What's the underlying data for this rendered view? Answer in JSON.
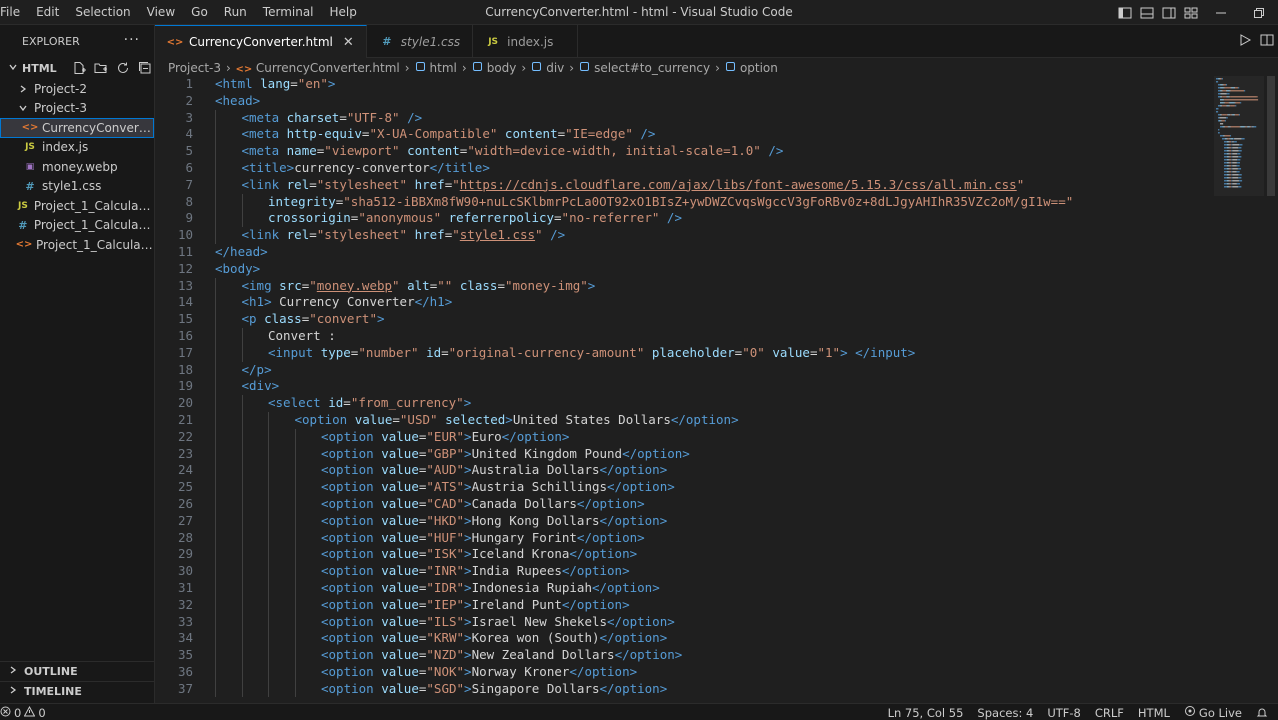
{
  "window": {
    "title": "CurrencyConverter.html - html - Visual Studio Code"
  },
  "menu": [
    "File",
    "Edit",
    "Selection",
    "View",
    "Go",
    "Run",
    "Terminal",
    "Help"
  ],
  "sidebar": {
    "header": "EXPLORER",
    "more": "···",
    "folder": "HTML",
    "items": [
      {
        "label": "Project-2",
        "type": "folder",
        "expanded": false,
        "depth": 1
      },
      {
        "label": "Project-3",
        "type": "folder",
        "expanded": true,
        "depth": 1
      },
      {
        "label": "CurrencyConverter.h...",
        "type": "html",
        "depth": 2,
        "selected": true
      },
      {
        "label": "index.js",
        "type": "js",
        "depth": 2
      },
      {
        "label": "money.webp",
        "type": "img",
        "depth": 2
      },
      {
        "label": "style1.css",
        "type": "css",
        "depth": 2
      },
      {
        "label": "Project_1_Calculator_...",
        "type": "js",
        "depth": 1
      },
      {
        "label": "Project_1_Calculator_...",
        "type": "css",
        "depth": 1
      },
      {
        "label": "Project_1_Calculator.h...",
        "type": "html",
        "depth": 1
      }
    ],
    "sections": [
      "OUTLINE",
      "TIMELINE"
    ]
  },
  "icons": {
    "html": "<>",
    "js": "JS",
    "css": "#",
    "img": "▣"
  },
  "tabs": [
    {
      "label": "CurrencyConverter.html",
      "type": "html",
      "active": true,
      "close": "✕"
    },
    {
      "label": "style1.css",
      "type": "css",
      "active": false,
      "italic": true
    },
    {
      "label": "index.js",
      "type": "js",
      "active": false
    }
  ],
  "breadcrumb": [
    "Project-3",
    "CurrencyConverter.html",
    "html",
    "body",
    "div",
    "select#to_currency",
    "option"
  ],
  "code_lines": [
    {
      "n": "1",
      "indent": 0,
      "tokens": [
        [
          "tag",
          "<html "
        ],
        [
          "attr",
          "lang"
        ],
        [
          "txt",
          "="
        ],
        [
          "str",
          "\"en\""
        ],
        [
          "tag",
          ">"
        ]
      ]
    },
    {
      "n": "2",
      "indent": 0,
      "tokens": [
        [
          "tag",
          "<head>"
        ]
      ]
    },
    {
      "n": "3",
      "indent": 1,
      "tokens": [
        [
          "tag",
          "<meta "
        ],
        [
          "attr",
          "charset"
        ],
        [
          "txt",
          "="
        ],
        [
          "str",
          "\"UTF-8\""
        ],
        [
          "tag",
          " />"
        ]
      ]
    },
    {
      "n": "4",
      "indent": 1,
      "tokens": [
        [
          "tag",
          "<meta "
        ],
        [
          "attr",
          "http-equiv"
        ],
        [
          "txt",
          "="
        ],
        [
          "str",
          "\"X-UA-Compatible\""
        ],
        [
          "txt",
          " "
        ],
        [
          "attr",
          "content"
        ],
        [
          "txt",
          "="
        ],
        [
          "str",
          "\"IE=edge\""
        ],
        [
          "tag",
          " />"
        ]
      ]
    },
    {
      "n": "5",
      "indent": 1,
      "tokens": [
        [
          "tag",
          "<meta "
        ],
        [
          "attr",
          "name"
        ],
        [
          "txt",
          "="
        ],
        [
          "str",
          "\"viewport\""
        ],
        [
          "txt",
          " "
        ],
        [
          "attr",
          "content"
        ],
        [
          "txt",
          "="
        ],
        [
          "str",
          "\"width=device-width, initial-scale=1.0\""
        ],
        [
          "tag",
          " />"
        ]
      ]
    },
    {
      "n": "6",
      "indent": 1,
      "tokens": [
        [
          "tag",
          "<title>"
        ],
        [
          "txt",
          "currency-convertor"
        ],
        [
          "tag",
          "</title>"
        ]
      ]
    },
    {
      "n": "7",
      "indent": 1,
      "tokens": [
        [
          "tag",
          "<link "
        ],
        [
          "attr",
          "rel"
        ],
        [
          "txt",
          "="
        ],
        [
          "str",
          "\"stylesheet\""
        ],
        [
          "txt",
          " "
        ],
        [
          "attr",
          "href"
        ],
        [
          "txt",
          "="
        ],
        [
          "str",
          "\""
        ],
        [
          "link",
          "https://cdnjs.cloudflare.com/ajax/libs/font-awesome/5.15.3/css/all.min.css"
        ],
        [
          "str",
          "\""
        ]
      ]
    },
    {
      "n": "8",
      "indent": 2,
      "tokens": [
        [
          "attr",
          "integrity"
        ],
        [
          "txt",
          "="
        ],
        [
          "str",
          "\"sha512-iBBXm8fW90+nuLcSKlbmrPcLa0OT92xO1BIsZ+ywDWZCvqsWgccV3gFoRBv0z+8dLJgyAHIhR35VZc2oM/gI1w==\""
        ]
      ]
    },
    {
      "n": "9",
      "indent": 2,
      "tokens": [
        [
          "attr",
          "crossorigin"
        ],
        [
          "txt",
          "="
        ],
        [
          "str",
          "\"anonymous\""
        ],
        [
          "txt",
          " "
        ],
        [
          "attr",
          "referrerpolicy"
        ],
        [
          "txt",
          "="
        ],
        [
          "str",
          "\"no-referrer\""
        ],
        [
          "tag",
          " />"
        ]
      ]
    },
    {
      "n": "10",
      "indent": 1,
      "tokens": [
        [
          "tag",
          "<link "
        ],
        [
          "attr",
          "rel"
        ],
        [
          "txt",
          "="
        ],
        [
          "str",
          "\"stylesheet\""
        ],
        [
          "txt",
          " "
        ],
        [
          "attr",
          "href"
        ],
        [
          "txt",
          "="
        ],
        [
          "str",
          "\""
        ],
        [
          "link",
          "style1.css"
        ],
        [
          "str",
          "\""
        ],
        [
          "tag",
          " />"
        ]
      ]
    },
    {
      "n": "11",
      "indent": 0,
      "tokens": [
        [
          "tag",
          "</head>"
        ]
      ]
    },
    {
      "n": "12",
      "indent": 0,
      "tokens": [
        [
          "tag",
          "<body>"
        ]
      ]
    },
    {
      "n": "13",
      "indent": 1,
      "tokens": [
        [
          "tag",
          "<img "
        ],
        [
          "attr",
          "src"
        ],
        [
          "txt",
          "="
        ],
        [
          "str",
          "\""
        ],
        [
          "link",
          "money.webp"
        ],
        [
          "str",
          "\""
        ],
        [
          "txt",
          " "
        ],
        [
          "attr",
          "alt"
        ],
        [
          "txt",
          "="
        ],
        [
          "str",
          "\"\""
        ],
        [
          "txt",
          " "
        ],
        [
          "attr",
          "class"
        ],
        [
          "txt",
          "="
        ],
        [
          "str",
          "\"money-img\""
        ],
        [
          "tag",
          ">"
        ]
      ]
    },
    {
      "n": "14",
      "indent": 1,
      "tokens": [
        [
          "tag",
          "<h1>"
        ],
        [
          "txt",
          " Currency Converter"
        ],
        [
          "tag",
          "</h1>"
        ]
      ]
    },
    {
      "n": "15",
      "indent": 1,
      "tokens": [
        [
          "tag",
          "<p "
        ],
        [
          "attr",
          "class"
        ],
        [
          "txt",
          "="
        ],
        [
          "str",
          "\"convert\""
        ],
        [
          "tag",
          ">"
        ]
      ]
    },
    {
      "n": "16",
      "indent": 2,
      "tokens": [
        [
          "txt",
          "Convert :"
        ]
      ]
    },
    {
      "n": "17",
      "indent": 2,
      "tokens": [
        [
          "tag",
          "<input "
        ],
        [
          "attr",
          "type"
        ],
        [
          "txt",
          "="
        ],
        [
          "str",
          "\"number\""
        ],
        [
          "txt",
          " "
        ],
        [
          "attr",
          "id"
        ],
        [
          "txt",
          "="
        ],
        [
          "str",
          "\"original-currency-amount\""
        ],
        [
          "txt",
          " "
        ],
        [
          "attr",
          "placeholder"
        ],
        [
          "txt",
          "="
        ],
        [
          "str",
          "\"0\""
        ],
        [
          "txt",
          " "
        ],
        [
          "attr",
          "value"
        ],
        [
          "txt",
          "="
        ],
        [
          "str",
          "\"1\""
        ],
        [
          "tag",
          ">"
        ],
        [
          "txt",
          " "
        ],
        [
          "tag",
          "</input>"
        ]
      ]
    },
    {
      "n": "18",
      "indent": 1,
      "tokens": [
        [
          "tag",
          "</p>"
        ]
      ]
    },
    {
      "n": "19",
      "indent": 1,
      "tokens": [
        [
          "tag",
          "<div>"
        ]
      ]
    },
    {
      "n": "20",
      "indent": 2,
      "tokens": [
        [
          "tag",
          "<select "
        ],
        [
          "attr",
          "id"
        ],
        [
          "txt",
          "="
        ],
        [
          "str",
          "\"from_currency\""
        ],
        [
          "tag",
          ">"
        ]
      ]
    },
    {
      "n": "21",
      "indent": 3,
      "tokens": [
        [
          "tag",
          "<option "
        ],
        [
          "attr",
          "value"
        ],
        [
          "txt",
          "="
        ],
        [
          "str",
          "\"USD\""
        ],
        [
          "txt",
          " "
        ],
        [
          "attr",
          "selected"
        ],
        [
          "tag",
          ">"
        ],
        [
          "txt",
          "United States Dollars"
        ],
        [
          "tag",
          "</option>"
        ]
      ]
    },
    {
      "n": "22",
      "indent": 4,
      "tokens": [
        [
          "tag",
          "<option "
        ],
        [
          "attr",
          "value"
        ],
        [
          "txt",
          "="
        ],
        [
          "str",
          "\"EUR\""
        ],
        [
          "tag",
          ">"
        ],
        [
          "txt",
          "Euro"
        ],
        [
          "tag",
          "</option>"
        ]
      ]
    },
    {
      "n": "23",
      "indent": 4,
      "tokens": [
        [
          "tag",
          "<option "
        ],
        [
          "attr",
          "value"
        ],
        [
          "txt",
          "="
        ],
        [
          "str",
          "\"GBP\""
        ],
        [
          "tag",
          ">"
        ],
        [
          "txt",
          "United Kingdom Pound"
        ],
        [
          "tag",
          "</option>"
        ]
      ]
    },
    {
      "n": "24",
      "indent": 4,
      "tokens": [
        [
          "tag",
          "<option "
        ],
        [
          "attr",
          "value"
        ],
        [
          "txt",
          "="
        ],
        [
          "str",
          "\"AUD\""
        ],
        [
          "tag",
          ">"
        ],
        [
          "txt",
          "Australia Dollars"
        ],
        [
          "tag",
          "</option>"
        ]
      ]
    },
    {
      "n": "25",
      "indent": 4,
      "tokens": [
        [
          "tag",
          "<option "
        ],
        [
          "attr",
          "value"
        ],
        [
          "txt",
          "="
        ],
        [
          "str",
          "\"ATS\""
        ],
        [
          "tag",
          ">"
        ],
        [
          "txt",
          "Austria Schillings"
        ],
        [
          "tag",
          "</option>"
        ]
      ]
    },
    {
      "n": "26",
      "indent": 4,
      "tokens": [
        [
          "tag",
          "<option "
        ],
        [
          "attr",
          "value"
        ],
        [
          "txt",
          "="
        ],
        [
          "str",
          "\"CAD\""
        ],
        [
          "tag",
          ">"
        ],
        [
          "txt",
          "Canada Dollars"
        ],
        [
          "tag",
          "</option>"
        ]
      ]
    },
    {
      "n": "27",
      "indent": 4,
      "tokens": [
        [
          "tag",
          "<option "
        ],
        [
          "attr",
          "value"
        ],
        [
          "txt",
          "="
        ],
        [
          "str",
          "\"HKD\""
        ],
        [
          "tag",
          ">"
        ],
        [
          "txt",
          "Hong Kong Dollars"
        ],
        [
          "tag",
          "</option>"
        ]
      ]
    },
    {
      "n": "28",
      "indent": 4,
      "tokens": [
        [
          "tag",
          "<option "
        ],
        [
          "attr",
          "value"
        ],
        [
          "txt",
          "="
        ],
        [
          "str",
          "\"HUF\""
        ],
        [
          "tag",
          ">"
        ],
        [
          "txt",
          "Hungary Forint"
        ],
        [
          "tag",
          "</option>"
        ]
      ]
    },
    {
      "n": "29",
      "indent": 4,
      "tokens": [
        [
          "tag",
          "<option "
        ],
        [
          "attr",
          "value"
        ],
        [
          "txt",
          "="
        ],
        [
          "str",
          "\"ISK\""
        ],
        [
          "tag",
          ">"
        ],
        [
          "txt",
          "Iceland Krona"
        ],
        [
          "tag",
          "</option>"
        ]
      ]
    },
    {
      "n": "30",
      "indent": 4,
      "tokens": [
        [
          "tag",
          "<option "
        ],
        [
          "attr",
          "value"
        ],
        [
          "txt",
          "="
        ],
        [
          "str",
          "\"INR\""
        ],
        [
          "tag",
          ">"
        ],
        [
          "txt",
          "India Rupees"
        ],
        [
          "tag",
          "</option>"
        ]
      ]
    },
    {
      "n": "31",
      "indent": 4,
      "tokens": [
        [
          "tag",
          "<option "
        ],
        [
          "attr",
          "value"
        ],
        [
          "txt",
          "="
        ],
        [
          "str",
          "\"IDR\""
        ],
        [
          "tag",
          ">"
        ],
        [
          "txt",
          "Indonesia Rupiah"
        ],
        [
          "tag",
          "</option>"
        ]
      ]
    },
    {
      "n": "32",
      "indent": 4,
      "tokens": [
        [
          "tag",
          "<option "
        ],
        [
          "attr",
          "value"
        ],
        [
          "txt",
          "="
        ],
        [
          "str",
          "\"IEP\""
        ],
        [
          "tag",
          ">"
        ],
        [
          "txt",
          "Ireland Punt"
        ],
        [
          "tag",
          "</option>"
        ]
      ]
    },
    {
      "n": "33",
      "indent": 4,
      "tokens": [
        [
          "tag",
          "<option "
        ],
        [
          "attr",
          "value"
        ],
        [
          "txt",
          "="
        ],
        [
          "str",
          "\"ILS\""
        ],
        [
          "tag",
          ">"
        ],
        [
          "txt",
          "Israel New Shekels"
        ],
        [
          "tag",
          "</option>"
        ]
      ]
    },
    {
      "n": "34",
      "indent": 4,
      "tokens": [
        [
          "tag",
          "<option "
        ],
        [
          "attr",
          "value"
        ],
        [
          "txt",
          "="
        ],
        [
          "str",
          "\"KRW\""
        ],
        [
          "tag",
          ">"
        ],
        [
          "txt",
          "Korea won (South)"
        ],
        [
          "tag",
          "</option>"
        ]
      ]
    },
    {
      "n": "35",
      "indent": 4,
      "tokens": [
        [
          "tag",
          "<option "
        ],
        [
          "attr",
          "value"
        ],
        [
          "txt",
          "="
        ],
        [
          "str",
          "\"NZD\""
        ],
        [
          "tag",
          ">"
        ],
        [
          "txt",
          "New Zealand Dollars"
        ],
        [
          "tag",
          "</option>"
        ]
      ]
    },
    {
      "n": "36",
      "indent": 4,
      "tokens": [
        [
          "tag",
          "<option "
        ],
        [
          "attr",
          "value"
        ],
        [
          "txt",
          "="
        ],
        [
          "str",
          "\"NOK\""
        ],
        [
          "tag",
          ">"
        ],
        [
          "txt",
          "Norway Kroner"
        ],
        [
          "tag",
          "</option>"
        ]
      ]
    },
    {
      "n": "37",
      "indent": 4,
      "tokens": [
        [
          "tag",
          "<option "
        ],
        [
          "attr",
          "value"
        ],
        [
          "txt",
          "="
        ],
        [
          "str",
          "\"SGD\""
        ],
        [
          "tag",
          ">"
        ],
        [
          "txt",
          "Singapore Dollars"
        ],
        [
          "tag",
          "</option>"
        ]
      ]
    }
  ],
  "statusbar": {
    "errors": "0",
    "warnings": "0",
    "position": "Ln 75, Col 55",
    "spaces": "Spaces: 4",
    "encoding": "UTF-8",
    "eol": "CRLF",
    "language": "HTML",
    "golive": "Go Live"
  },
  "colors": {
    "accent": "#0078d4",
    "tag": "#569cd6",
    "attribute": "#9cdcfe",
    "string": "#ce9178",
    "text": "#d4d4d4"
  }
}
